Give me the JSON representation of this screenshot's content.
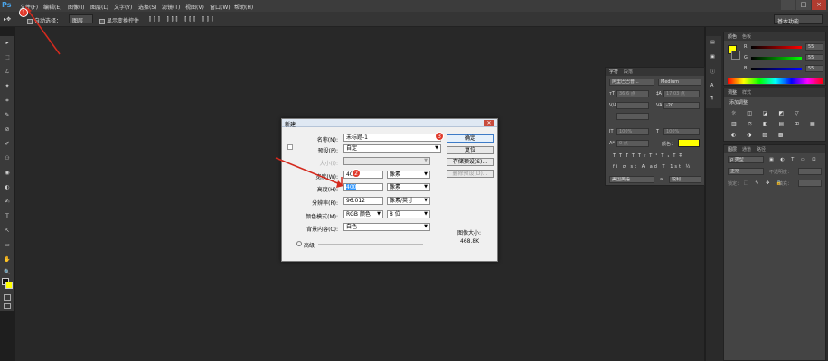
{
  "menubar": {
    "logo": "Ps",
    "items": [
      "文件(F)",
      "编辑(E)",
      "图像(I)",
      "图层(L)",
      "文字(Y)",
      "选择(S)",
      "滤镜(T)",
      "视图(V)",
      "窗口(W)",
      "帮助(H)"
    ],
    "window_buttons": [
      "–",
      "□",
      "×"
    ]
  },
  "options_bar": {
    "auto_select": "自动选择：",
    "layer_select": "图层",
    "show_transform": "显示变换控件",
    "workspace": "基本功能"
  },
  "tools": [
    "▸",
    "⬚",
    "ℒ",
    "✦",
    "⌗",
    "✎",
    "⊘",
    "✐",
    "⚇",
    "◉",
    "◐",
    "✍",
    "T",
    "↖",
    "▭",
    "✋",
    "🔍"
  ],
  "panels": {
    "character": {
      "tabs": [
        "字符",
        "段落"
      ],
      "font_family": "阿里巴巴普...",
      "font_style": "Medium",
      "size": "36.6 点",
      "leading": "17.03 点",
      "tracking_label": "VA",
      "tracking": "-20",
      "scale_v": "100%",
      "scale_h": "100%",
      "baseline": "0 点",
      "color_label": "颜色：",
      "styles": [
        "T",
        "T",
        "TT",
        "Tr",
        "T¹",
        "T₁",
        "T",
        "T̶"
      ],
      "special": [
        "fi",
        "σ",
        "st",
        "A",
        "ad",
        "T",
        "1st",
        "½"
      ],
      "language": "美国英语",
      "antialias": "a",
      "aa_mode": "锐利",
      "text_color": "#ffff00"
    },
    "color": {
      "tabs": [
        "颜色",
        "色板"
      ],
      "r_label": "R",
      "g_label": "G",
      "b_label": "B",
      "r": "55",
      "g": "55",
      "b": "55"
    },
    "adjustments": {
      "tabs": [
        "调整",
        "样式"
      ],
      "title": "添加调整"
    },
    "layers": {
      "tabs": [
        "图层",
        "通道",
        "路径"
      ],
      "kind_label": "ρ 类型",
      "blend": "正常",
      "opacity_label": "不透明度：",
      "lock_label": "锁定：",
      "fill_label": "填充："
    }
  },
  "dialog": {
    "title": "新建",
    "name_label": "名称(N):",
    "name_value": "未标题-1",
    "preset_label": "预设(P):",
    "preset_value": "自定",
    "size_label": "大小(I):",
    "width_label": "宽度(W):",
    "width_value": "400",
    "width_unit": "像素",
    "height_label": "高度(H):",
    "height_value": "400",
    "height_unit": "像素",
    "resolution_label": "分辨率(R):",
    "resolution_value": "96.012",
    "resolution_unit": "像素/英寸",
    "color_mode_label": "颜色模式(M):",
    "color_mode_value": "RGB 颜色",
    "bit_depth": "8 位",
    "background_label": "背景内容(C):",
    "background_value": "白色",
    "advanced_label": "高级",
    "ok": "确定",
    "reset": "复位",
    "save_preset": "存储预设(S)...",
    "delete_preset": "删除预设(D)...",
    "image_size_label": "图像大小:",
    "image_size_value": "468.8K"
  },
  "annotations": [
    "1",
    "2",
    "3"
  ]
}
